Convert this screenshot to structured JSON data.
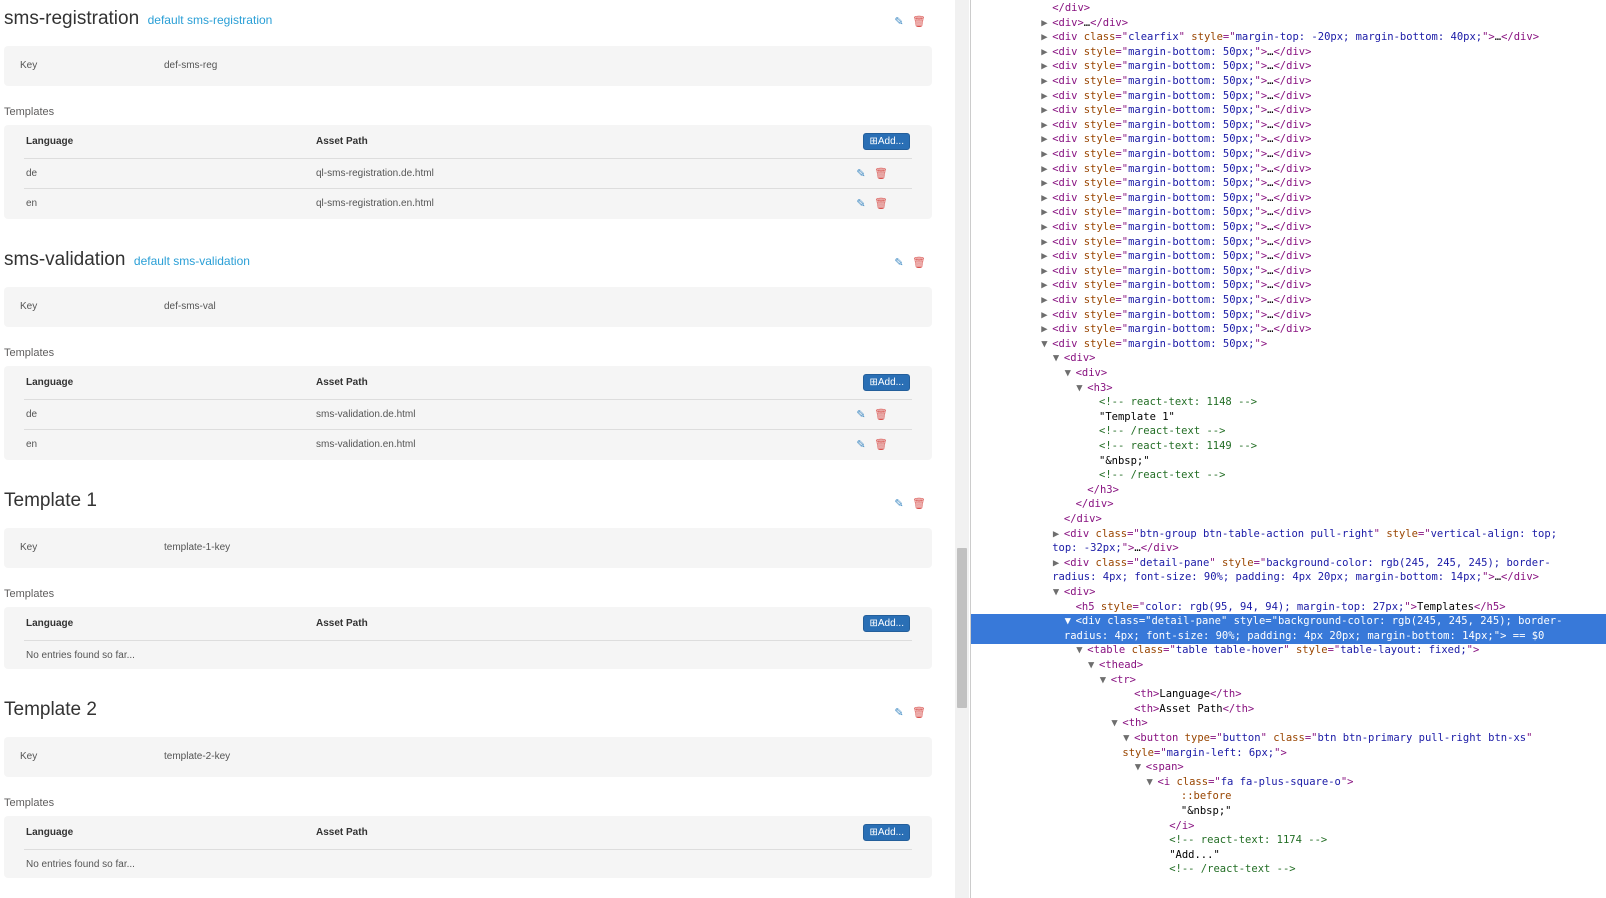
{
  "sections": [
    {
      "name": "sms-registration",
      "subtitle": "default sms-registration",
      "key_label": "Key",
      "key_value": "def-sms-reg",
      "templates_label": "Templates",
      "columns": [
        "Language",
        "Asset Path"
      ],
      "add_label": "Add...",
      "rows": [
        {
          "lang": "de",
          "path": "ql-sms-registration.de.html"
        },
        {
          "lang": "en",
          "path": "ql-sms-registration.en.html"
        }
      ],
      "empty_text": ""
    },
    {
      "name": "sms-validation",
      "subtitle": "default sms-validation",
      "key_label": "Key",
      "key_value": "def-sms-val",
      "templates_label": "Templates",
      "columns": [
        "Language",
        "Asset Path"
      ],
      "add_label": "Add...",
      "rows": [
        {
          "lang": "de",
          "path": "sms-validation.de.html"
        },
        {
          "lang": "en",
          "path": "sms-validation.en.html"
        }
      ],
      "empty_text": ""
    },
    {
      "name": "Template 1",
      "subtitle": "",
      "key_label": "Key",
      "key_value": "template-1-key",
      "templates_label": "Templates",
      "columns": [
        "Language",
        "Asset Path"
      ],
      "add_label": "Add...",
      "rows": [],
      "empty_text": "No entries found so far..."
    },
    {
      "name": "Template 2",
      "subtitle": "",
      "key_label": "Key",
      "key_value": "template-2-key",
      "templates_label": "Templates",
      "columns": [
        "Language",
        "Asset Path"
      ],
      "add_label": "Add...",
      "rows": [],
      "empty_text": "No entries found so far..."
    }
  ],
  "icons": {
    "edit": "edit-icon",
    "delete": "trash-icon",
    "add": "plus-square-icon"
  },
  "colors": {
    "subtitle": "#2a9fd6",
    "add_button": "#2a6fb5",
    "delete": "#d9534f",
    "edit": "#3a87c2",
    "pane": "#f5f5f5",
    "selection": "#3879d9"
  },
  "devtools": {
    "lines": [
      {
        "indent": 6,
        "tri": "",
        "segs": [
          [
            "tag",
            "</div>"
          ]
        ]
      },
      {
        "indent": 6,
        "tri": "▶",
        "segs": [
          [
            "tag",
            "<div>"
          ],
          [
            "txt",
            "…"
          ],
          [
            "tag",
            "</div>"
          ]
        ]
      },
      {
        "indent": 6,
        "tri": "▶",
        "segs": [
          [
            "tag",
            "<div "
          ],
          [
            "attr",
            "class"
          ],
          [
            "tag",
            "=\""
          ],
          [
            "val",
            "clearfix"
          ],
          [
            "tag",
            "\" "
          ],
          [
            "attr",
            "style"
          ],
          [
            "tag",
            "=\""
          ],
          [
            "val",
            "margin-top: -20px; margin-bottom: 40px;"
          ],
          [
            "tag",
            "\">"
          ],
          [
            "txt",
            "…"
          ],
          [
            "tag",
            "</div>"
          ]
        ]
      },
      {
        "indent": 6,
        "tri": "▶",
        "rep": 20,
        "segs": [
          [
            "tag",
            "<div "
          ],
          [
            "attr",
            "style"
          ],
          [
            "tag",
            "=\""
          ],
          [
            "val",
            "margin-bottom: 50px;"
          ],
          [
            "tag",
            "\">"
          ],
          [
            "txt",
            "…"
          ],
          [
            "tag",
            "</div>"
          ]
        ]
      },
      {
        "indent": 6,
        "tri": "▼",
        "segs": [
          [
            "tag",
            "<div "
          ],
          [
            "attr",
            "style"
          ],
          [
            "tag",
            "=\""
          ],
          [
            "val",
            "margin-bottom: 50px;"
          ],
          [
            "tag",
            "\">"
          ]
        ]
      },
      {
        "indent": 7,
        "tri": "▼",
        "segs": [
          [
            "tag",
            "<div>"
          ]
        ]
      },
      {
        "indent": 8,
        "tri": "▼",
        "segs": [
          [
            "tag",
            "<div>"
          ]
        ]
      },
      {
        "indent": 9,
        "tri": "▼",
        "segs": [
          [
            "tag",
            "<h3>"
          ]
        ]
      },
      {
        "indent": 10,
        "tri": "",
        "segs": [
          [
            "cmt",
            "<!-- react-text: 1148 -->"
          ]
        ]
      },
      {
        "indent": 10,
        "tri": "",
        "segs": [
          [
            "txt",
            "\"Template 1\""
          ]
        ]
      },
      {
        "indent": 10,
        "tri": "",
        "segs": [
          [
            "cmt",
            "<!-- /react-text -->"
          ]
        ]
      },
      {
        "indent": 10,
        "tri": "",
        "segs": [
          [
            "cmt",
            "<!-- react-text: 1149 -->"
          ]
        ]
      },
      {
        "indent": 10,
        "tri": "",
        "segs": [
          [
            "txt",
            "\"&nbsp;\""
          ]
        ]
      },
      {
        "indent": 10,
        "tri": "",
        "segs": [
          [
            "cmt",
            "<!-- /react-text -->"
          ]
        ]
      },
      {
        "indent": 9,
        "tri": "",
        "segs": [
          [
            "tag",
            "</h3>"
          ]
        ]
      },
      {
        "indent": 8,
        "tri": "",
        "segs": [
          [
            "tag",
            "</div>"
          ]
        ]
      },
      {
        "indent": 7,
        "tri": "",
        "segs": [
          [
            "tag",
            "</div>"
          ]
        ]
      },
      {
        "indent": 7,
        "tri": "▶",
        "segs": [
          [
            "tag",
            "<div "
          ],
          [
            "attr",
            "class"
          ],
          [
            "tag",
            "=\""
          ],
          [
            "val",
            "btn-group btn-table-action pull-right"
          ],
          [
            "tag",
            "\" "
          ],
          [
            "attr",
            "style"
          ],
          [
            "tag",
            "=\""
          ],
          [
            "val",
            "vertical-align: top;"
          ]
        ]
      },
      {
        "indent": 6,
        "tri": "",
        "segs": [
          [
            "val",
            "top: -32px;"
          ],
          [
            "tag",
            "\">"
          ],
          [
            "txt",
            "…"
          ],
          [
            "tag",
            "</div>"
          ]
        ]
      },
      {
        "indent": 7,
        "tri": "▶",
        "segs": [
          [
            "tag",
            "<div "
          ],
          [
            "attr",
            "class"
          ],
          [
            "tag",
            "=\""
          ],
          [
            "val",
            "detail-pane"
          ],
          [
            "tag",
            "\" "
          ],
          [
            "attr",
            "style"
          ],
          [
            "tag",
            "=\""
          ],
          [
            "val",
            "background-color: rgb(245, 245, 245); border-"
          ]
        ]
      },
      {
        "indent": 6,
        "tri": "",
        "segs": [
          [
            "val",
            "radius: 4px; font-size: 90%; padding: 4px 20px; margin-bottom: 14px;"
          ],
          [
            "tag",
            "\">"
          ],
          [
            "txt",
            "…"
          ],
          [
            "tag",
            "</div>"
          ]
        ]
      },
      {
        "indent": 7,
        "tri": "▼",
        "segs": [
          [
            "tag",
            "<div>"
          ]
        ]
      },
      {
        "indent": 8,
        "tri": "",
        "segs": [
          [
            "tag",
            "<h5 "
          ],
          [
            "attr",
            "style"
          ],
          [
            "tag",
            "=\""
          ],
          [
            "val",
            "color: rgb(95, 94, 94); margin-top: 27px;"
          ],
          [
            "tag",
            "\">"
          ],
          [
            "txt",
            "Templates"
          ],
          [
            "tag",
            "</h5>"
          ]
        ]
      },
      {
        "indent": 8,
        "tri": "▼",
        "sel": true,
        "segs": [
          [
            "tag",
            "<div "
          ],
          [
            "attr",
            "class"
          ],
          [
            "tag",
            "=\""
          ],
          [
            "val",
            "detail-pane"
          ],
          [
            "tag",
            "\" "
          ],
          [
            "attr",
            "style"
          ],
          [
            "tag",
            "=\""
          ],
          [
            "val",
            "background-color: rgb(245, 245, 245); border-"
          ]
        ]
      },
      {
        "indent": 7,
        "tri": "",
        "sel": true,
        "segs": [
          [
            "val",
            "radius: 4px; font-size: 90%; padding: 4px 20px; margin-bottom: 14px;"
          ],
          [
            "tag",
            "\">"
          ],
          [
            "txt",
            " == $0"
          ]
        ]
      },
      {
        "indent": 9,
        "tri": "▼",
        "segs": [
          [
            "tag",
            "<table "
          ],
          [
            "attr",
            "class"
          ],
          [
            "tag",
            "=\""
          ],
          [
            "val",
            "table table-hover"
          ],
          [
            "tag",
            "\" "
          ],
          [
            "attr",
            "style"
          ],
          [
            "tag",
            "=\""
          ],
          [
            "val",
            "table-layout: fixed;"
          ],
          [
            "tag",
            "\">"
          ]
        ]
      },
      {
        "indent": 10,
        "tri": "▼",
        "segs": [
          [
            "tag",
            "<thead>"
          ]
        ]
      },
      {
        "indent": 11,
        "tri": "▼",
        "segs": [
          [
            "tag",
            "<tr>"
          ]
        ]
      },
      {
        "indent": 13,
        "tri": "",
        "segs": [
          [
            "tag",
            "<th>"
          ],
          [
            "txt",
            "Language"
          ],
          [
            "tag",
            "</th>"
          ]
        ]
      },
      {
        "indent": 13,
        "tri": "",
        "segs": [
          [
            "tag",
            "<th>"
          ],
          [
            "txt",
            "Asset Path"
          ],
          [
            "tag",
            "</th>"
          ]
        ]
      },
      {
        "indent": 12,
        "tri": "▼",
        "segs": [
          [
            "tag",
            "<th>"
          ]
        ]
      },
      {
        "indent": 13,
        "tri": "▼",
        "segs": [
          [
            "tag",
            "<button "
          ],
          [
            "attr",
            "type"
          ],
          [
            "tag",
            "=\""
          ],
          [
            "val",
            "button"
          ],
          [
            "tag",
            "\" "
          ],
          [
            "attr",
            "class"
          ],
          [
            "tag",
            "=\""
          ],
          [
            "val",
            "btn btn-primary pull-right btn-xs"
          ],
          [
            "tag",
            "\""
          ]
        ]
      },
      {
        "indent": 12,
        "tri": "",
        "segs": [
          [
            "attr",
            "style"
          ],
          [
            "tag",
            "=\""
          ],
          [
            "val",
            "margin-left: 6px;"
          ],
          [
            "tag",
            "\">"
          ]
        ]
      },
      {
        "indent": 14,
        "tri": "▼",
        "segs": [
          [
            "tag",
            "<span>"
          ]
        ]
      },
      {
        "indent": 15,
        "tri": "▼",
        "segs": [
          [
            "tag",
            "<i "
          ],
          [
            "attr",
            "class"
          ],
          [
            "tag",
            "=\""
          ],
          [
            "val",
            "fa fa-plus-square-o"
          ],
          [
            "tag",
            "\">"
          ]
        ]
      },
      {
        "indent": 17,
        "tri": "",
        "segs": [
          [
            "attr",
            "::before"
          ]
        ]
      },
      {
        "indent": 17,
        "tri": "",
        "segs": [
          [
            "txt",
            "\"&nbsp;\""
          ]
        ]
      },
      {
        "indent": 16,
        "tri": "",
        "segs": [
          [
            "tag",
            "</i>"
          ]
        ]
      },
      {
        "indent": 16,
        "tri": "",
        "segs": [
          [
            "cmt",
            "<!-- react-text: 1174 -->"
          ]
        ]
      },
      {
        "indent": 16,
        "tri": "",
        "segs": [
          [
            "txt",
            "\"Add...\""
          ]
        ]
      },
      {
        "indent": 16,
        "tri": "",
        "segs": [
          [
            "cmt",
            "<!-- /react-text -->"
          ]
        ]
      }
    ]
  }
}
